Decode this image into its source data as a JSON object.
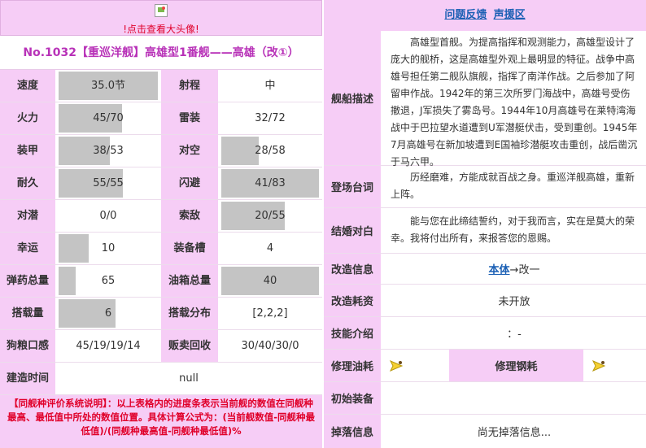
{
  "avatar": {
    "link_text": "!点击查看大头像!"
  },
  "ship_title": "No.1032【重巡洋舰】高雄型1番舰——高雄（改①）",
  "stats": {
    "speed": {
      "label": "速度",
      "value": "35.0节",
      "fill": 1.0
    },
    "range": {
      "label": "射程",
      "value": "中"
    },
    "firepower": {
      "label": "火力",
      "value": "45/70",
      "fill": 0.64
    },
    "torpedo": {
      "label": "雷装",
      "value": "32/72"
    },
    "armor": {
      "label": "装甲",
      "value": "38/53",
      "fill": 0.52
    },
    "aa": {
      "label": "对空",
      "value": "28/58",
      "fill": 0.38
    },
    "hp": {
      "label": "耐久",
      "value": "55/55",
      "fill": 0.65
    },
    "evasion": {
      "label": "闪避",
      "value": "41/83",
      "fill": 1.0
    },
    "asw": {
      "label": "对潜",
      "value": "0/0"
    },
    "los": {
      "label": "索敌",
      "value": "20/55",
      "fill": 0.65
    },
    "luck": {
      "label": "幸运",
      "value": "10",
      "fill": 0.3
    },
    "slots": {
      "label": "装备槽",
      "value": "4"
    },
    "ammo": {
      "label": "弹药总量",
      "value": "65",
      "fill": 0.17
    },
    "fuel": {
      "label": "油箱总量",
      "value": "40",
      "fill": 1.0
    },
    "aircraft": {
      "label": "搭载量",
      "value": "6",
      "fill": 0.57
    },
    "aircraft_dist": {
      "label": "搭载分布",
      "value": "[2,2,2]"
    },
    "taste": {
      "label": "狗粮口感",
      "value": "45/19/19/14"
    },
    "scrap": {
      "label": "贩卖回收",
      "value": "30/40/30/0"
    },
    "build_time": {
      "label": "建造时间",
      "value": "null"
    }
  },
  "note": "【同舰种评价系统说明】：以上表格内的进度条表示当前舰的数值在同舰种最高、最低值中所处的数值位置。具体计算公式为：(当前舰数值-同舰种最低值)/(同舰种最高值-同舰种最低值)%",
  "feedback": {
    "issue": "问题反馈",
    "voice": "声援区"
  },
  "details": {
    "desc_label": "舰船描述",
    "desc": "高雄型首舰。为提高指挥和观测能力，高雄型设计了庞大的舰桥，这是高雄型外观上最明显的特征。战争中高雄号担任第二舰队旗舰，指挥了南洋作战。之后参加了阿留申作战。1942年的第三次所罗门海战中，高雄号受伤撤退，J军损失了雾岛号。1944年10月高雄号在莱特湾海战中于巴拉望水道遭到U军潜艇伏击，受到重创。1945年7月高雄号在新加坡遭到E国袖珍潜艇攻击重创，战后凿沉于马六甲。",
    "intro_label": "登场台词",
    "intro": "历经磨难，方能成就百战之身。重巡洋舰高雄，重新上阵。",
    "marriage_label": "结婚对白",
    "marriage": "能与您在此缔结誓约，对于我而言，实在是莫大的荣幸。我将付出所有，来报答您的恩赐。",
    "remodel_label": "改造信息",
    "remodel_link": "本体",
    "remodel_rest": "→改一",
    "remodel_cost_label": "改造耗资",
    "remodel_cost": "未开放",
    "skill_label": "技能介绍",
    "skill": "：-",
    "repair_fuel_label": "修理油耗",
    "repair_steel_label": "修理钢耗",
    "initial_equip_label": "初始装备",
    "drop_label": "掉落信息",
    "drop": "尚无掉落信息..."
  },
  "colors": {
    "label_bg": "#f6cdf6",
    "title": "#b832b8",
    "accent_red": "#e0002a",
    "link": "#1a5fb4",
    "bar": "#c4c4c4"
  }
}
